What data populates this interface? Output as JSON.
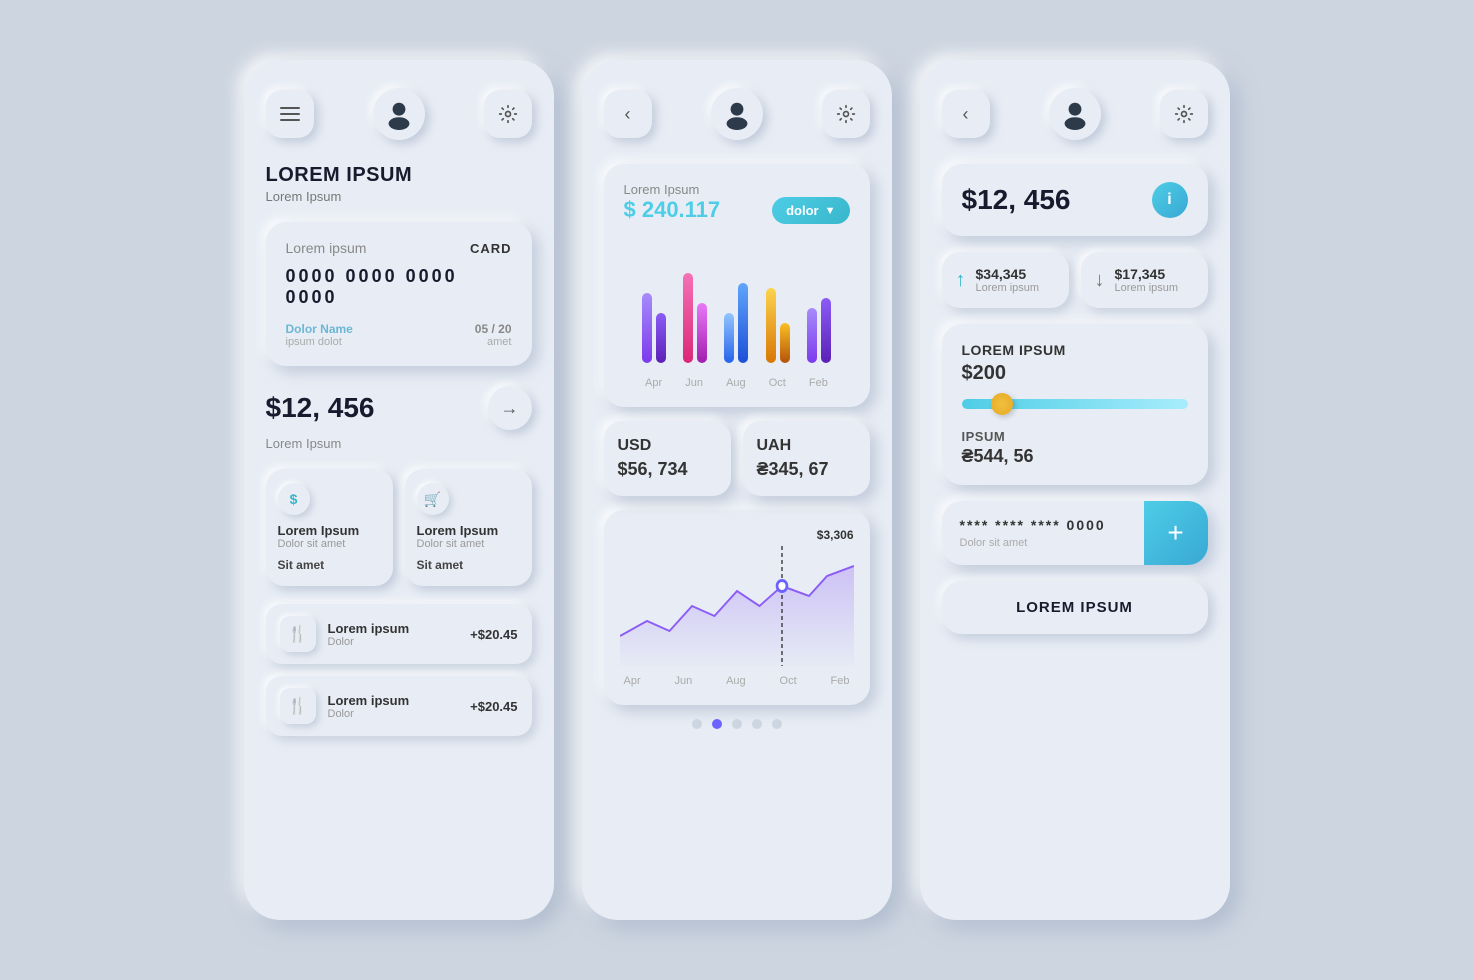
{
  "screens": {
    "screen1": {
      "header": {
        "menu_label": "menu",
        "settings_label": "settings"
      },
      "title": "LOREM IPSUM",
      "subtitle": "Lorem Ipsum",
      "card": {
        "label": "Lorem ipsum",
        "badge": "CARD",
        "number": "0000 0000 0000 0000",
        "name_label": "Dolor Name",
        "name_sub": "ipsum dolot",
        "date_label": "05 / 20",
        "date_sub": "amet"
      },
      "balance": {
        "amount": "$12, 456",
        "label": "Lorem Ipsum"
      },
      "actions": [
        {
          "icon": "$",
          "title": "Lorem Ipsum",
          "sub": "Dolor sit amet",
          "link": "Sit amet"
        },
        {
          "icon": "🛒",
          "title": "Lorem Ipsum",
          "sub": "Dolor sit amet",
          "link": "Sit amet"
        }
      ],
      "transactions": [
        {
          "title": "Lorem ipsum",
          "sub": "Dolor",
          "amount": "+$20.45"
        },
        {
          "title": "Lorem ipsum",
          "sub": "Dolor",
          "amount": "+$20.45"
        }
      ]
    },
    "screen2": {
      "header_label": "Lorem Ipsum",
      "amount": "$ 240.117",
      "filter_btn": "dolor",
      "bar_chart": {
        "labels": [
          "Apr",
          "Jun",
          "Aug",
          "Oct",
          "Feb"
        ],
        "bars": [
          {
            "color1": "#8b5cf6",
            "color2": "#6d4c8b",
            "h1": 70,
            "h2": 50
          },
          {
            "color1": "#ec4899",
            "color2": "#c026d3",
            "h1": 90,
            "h2": 60
          },
          {
            "color1": "#60a5fa",
            "color2": "#3b82f6",
            "h1": 50,
            "h2": 80
          },
          {
            "color1": "#fbbf24",
            "color2": "#f59e0b",
            "h1": 75,
            "h2": 40
          },
          {
            "color1": "#8b5cf6",
            "color2": "#6d4c8b",
            "h1": 55,
            "h2": 65
          }
        ]
      },
      "usd": {
        "label": "USD",
        "value": "$56, 734"
      },
      "uah": {
        "label": "UAH",
        "value": "₴345, 67"
      },
      "line_chart": {
        "tooltip": "$3,306",
        "x_labels": [
          "Apr",
          "Jun",
          "Aug",
          "Oct",
          "Feb"
        ]
      },
      "dots": [
        false,
        true,
        false,
        false,
        false
      ]
    },
    "screen3": {
      "balance": "$12, 456",
      "income": {
        "value": "$34,345",
        "label": "Lorem ipsum"
      },
      "expense": {
        "value": "$17,345",
        "label": "Lorem ipsum"
      },
      "slider_section": {
        "title": "LOREM IPSUM",
        "value": "$200"
      },
      "ipsum_section": {
        "title": "IPSUM",
        "value": "₴544, 56"
      },
      "card_add": {
        "number": "**** **** **** 0000",
        "label": "Dolor sit amet",
        "plus": "+"
      },
      "submit_btn": "LOREM IPSUM"
    }
  }
}
